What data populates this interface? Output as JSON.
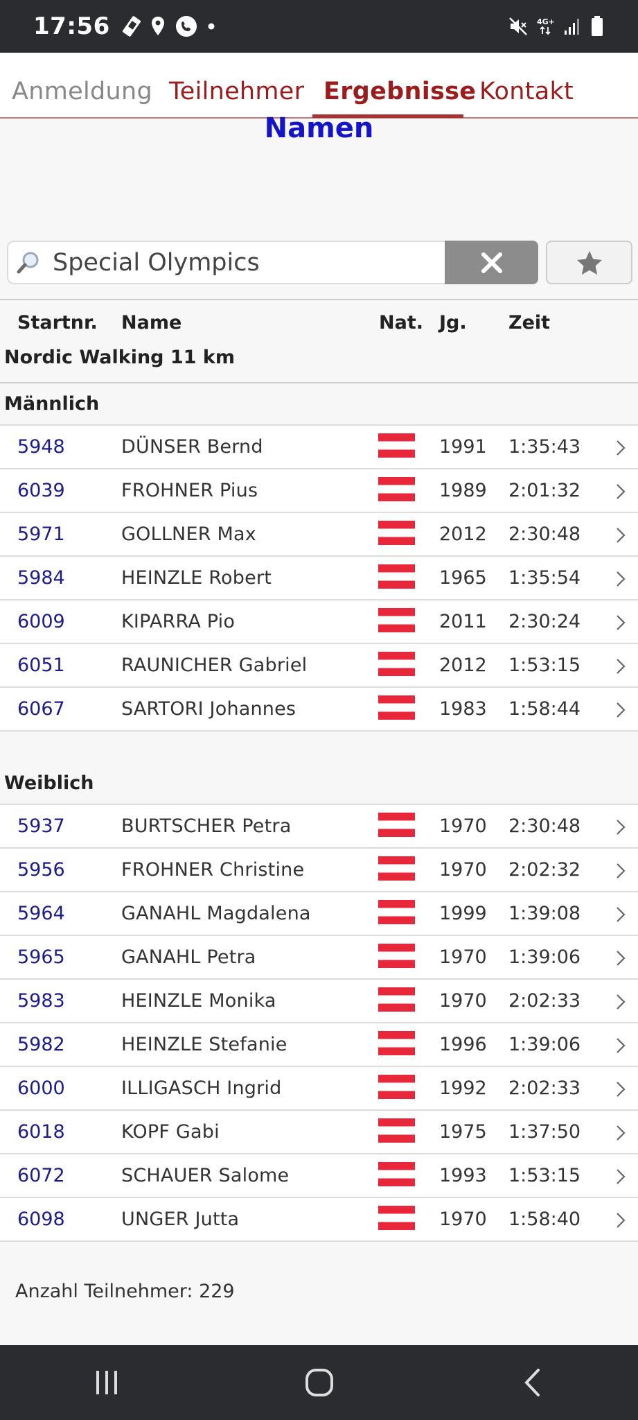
{
  "status_bar": {
    "time": "17:56",
    "left_icons": [
      "sim-icon",
      "location-icon",
      "call-icon",
      "dot-icon"
    ],
    "right_icons": [
      "mute-icon",
      "4g-icon",
      "signal-icon",
      "battery-icon"
    ],
    "network": "4G+"
  },
  "tabs": [
    {
      "label": "Anmeldung",
      "active": false
    },
    {
      "label": "Teilnehmer",
      "active": false
    },
    {
      "label": "Ergebnisse",
      "active": true
    },
    {
      "label": "Kontakt",
      "active": false
    }
  ],
  "page_title": "Namen",
  "search": {
    "value": "Special Olympics",
    "clear_icon": "close-icon",
    "favorite_icon": "star-icon"
  },
  "table": {
    "headers": [
      "Startnr.",
      "Name",
      "Nat.",
      "Jg.",
      "Zeit"
    ],
    "competition": "Nordic Walking 11 km",
    "groups": [
      {
        "label": "Männlich",
        "rows": [
          {
            "nr": "5948",
            "name": "DÜNSER Bernd",
            "nat": "AUT-flag",
            "jg": "1991",
            "zeit": "1:35:43"
          },
          {
            "nr": "6039",
            "name": "FROHNER Pius",
            "nat": "AUT-flag",
            "jg": "1989",
            "zeit": "2:01:32"
          },
          {
            "nr": "5971",
            "name": "GOLLNER Max",
            "nat": "AUT-flag",
            "jg": "2012",
            "zeit": "2:30:48"
          },
          {
            "nr": "5984",
            "name": "HEINZLE Robert",
            "nat": "AUT-flag",
            "jg": "1965",
            "zeit": "1:35:54"
          },
          {
            "nr": "6009",
            "name": "KIPARRA Pio",
            "nat": "AUT-flag",
            "jg": "2011",
            "zeit": "2:30:24"
          },
          {
            "nr": "6051",
            "name": "RAUNICHER Gabriel",
            "nat": "AUT-flag",
            "jg": "2012",
            "zeit": "1:53:15"
          },
          {
            "nr": "6067",
            "name": "SARTORI Johannes",
            "nat": "AUT-flag",
            "jg": "1983",
            "zeit": "1:58:44"
          }
        ]
      },
      {
        "label": "Weiblich",
        "rows": [
          {
            "nr": "5937",
            "name": "BURTSCHER Petra",
            "nat": "AUT-flag",
            "jg": "1970",
            "zeit": "2:30:48"
          },
          {
            "nr": "5956",
            "name": "FROHNER Christine",
            "nat": "AUT-flag",
            "jg": "1970",
            "zeit": "2:02:32"
          },
          {
            "nr": "5964",
            "name": "GANAHL Magdalena",
            "nat": "AUT-flag",
            "jg": "1999",
            "zeit": "1:39:08"
          },
          {
            "nr": "5965",
            "name": "GANAHL Petra",
            "nat": "AUT-flag",
            "jg": "1970",
            "zeit": "1:39:06"
          },
          {
            "nr": "5983",
            "name": "HEINZLE Monika",
            "nat": "AUT-flag",
            "jg": "1970",
            "zeit": "2:02:33"
          },
          {
            "nr": "5982",
            "name": "HEINZLE Stefanie",
            "nat": "AUT-flag",
            "jg": "1996",
            "zeit": "1:39:06"
          },
          {
            "nr": "6000",
            "name": "ILLIGASCH Ingrid",
            "nat": "AUT-flag",
            "jg": "1992",
            "zeit": "2:02:33"
          },
          {
            "nr": "6018",
            "name": "KOPF Gabi",
            "nat": "AUT-flag",
            "jg": "1975",
            "zeit": "1:37:50"
          },
          {
            "nr": "6072",
            "name": "SCHAUER Salome",
            "nat": "AUT-flag",
            "jg": "1993",
            "zeit": "1:53:15"
          },
          {
            "nr": "6098",
            "name": "UNGER Jutta",
            "nat": "AUT-flag",
            "jg": "1970",
            "zeit": "1:58:40"
          }
        ]
      }
    ]
  },
  "footer": {
    "participants_text": "Anzahl Teilnehmer: 229"
  },
  "nav_bar": [
    "recent-apps-icon",
    "home-icon",
    "back-icon"
  ],
  "colors": {
    "accent": "#9b1c1c",
    "title_blue": "#1515c8",
    "startnr_blue": "#1c1c8c",
    "flag_red": "#e8283a",
    "system_bar": "#2b2c30"
  }
}
